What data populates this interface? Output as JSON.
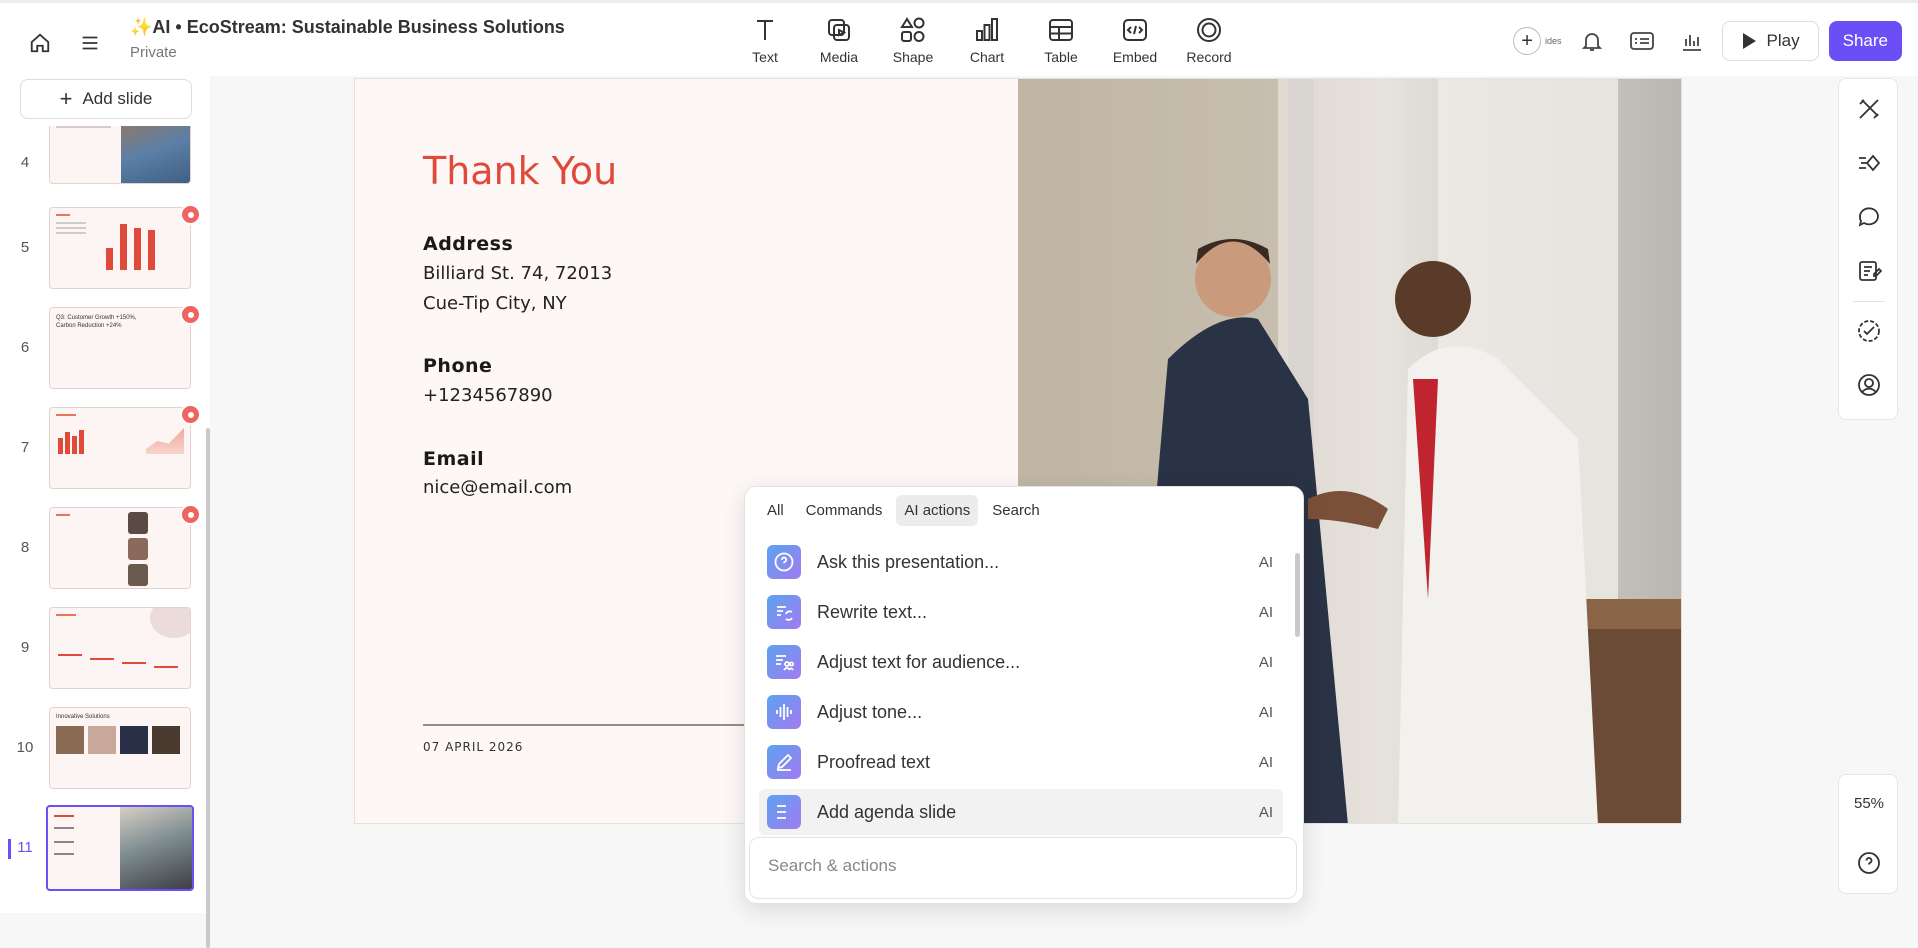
{
  "header": {
    "title": "AI • EcoStream: Sustainable Business Solutions",
    "visibility": "Private",
    "tools": [
      {
        "label": "Text",
        "icon": "text-icon"
      },
      {
        "label": "Media",
        "icon": "media-icon"
      },
      {
        "label": "Shape",
        "icon": "shape-icon"
      },
      {
        "label": "Chart",
        "icon": "chart-icon"
      },
      {
        "label": "Table",
        "icon": "table-icon"
      },
      {
        "label": "Embed",
        "icon": "embed-icon"
      },
      {
        "label": "Record",
        "icon": "record-icon"
      }
    ],
    "ides_label": "ides",
    "play_label": "Play",
    "share_label": "Share"
  },
  "sidebar": {
    "add_slide_label": "Add slide",
    "slides": [
      {
        "number": "4",
        "comment": true
      },
      {
        "number": "5",
        "comment": true
      },
      {
        "number": "6",
        "comment": true,
        "caption": "Q3: Customer Growth +150%, Carbon Reduction +24%"
      },
      {
        "number": "7",
        "comment": true
      },
      {
        "number": "8",
        "comment": true
      },
      {
        "number": "9",
        "comment": false
      },
      {
        "number": "10",
        "comment": false,
        "caption": "Innovative Solutions"
      },
      {
        "number": "11",
        "comment": false,
        "active": true
      }
    ]
  },
  "slide": {
    "title": "Thank You",
    "address_label": "Address",
    "address_line1": "Billiard St. 74, 72013",
    "address_line2": "Cue-Tip City, NY",
    "phone_label": "Phone",
    "phone": "+1234567890",
    "email_label": "Email",
    "email": "nice@email.com",
    "date": "07 APRIL 2026"
  },
  "popup": {
    "tabs": [
      "All",
      "Commands",
      "AI actions",
      "Search"
    ],
    "active_tab": "AI actions",
    "items": [
      {
        "label": "Ask this presentation...",
        "tag": "AI",
        "icon": "question-icon"
      },
      {
        "label": "Rewrite text...",
        "tag": "AI",
        "icon": "rewrite-icon"
      },
      {
        "label": "Adjust text for audience...",
        "tag": "AI",
        "icon": "audience-icon"
      },
      {
        "label": "Adjust tone...",
        "tag": "AI",
        "icon": "tone-icon"
      },
      {
        "label": "Proofread text",
        "tag": "AI",
        "icon": "pencil-icon"
      },
      {
        "label": "Add agenda slide",
        "tag": "AI",
        "icon": "agenda-icon"
      }
    ],
    "search_placeholder": "Search & actions"
  },
  "zoom": {
    "level": "55%"
  },
  "colors": {
    "accent": "#6b4ef6",
    "title_red": "#e04a3a",
    "comment_dot": "#ee6462"
  }
}
